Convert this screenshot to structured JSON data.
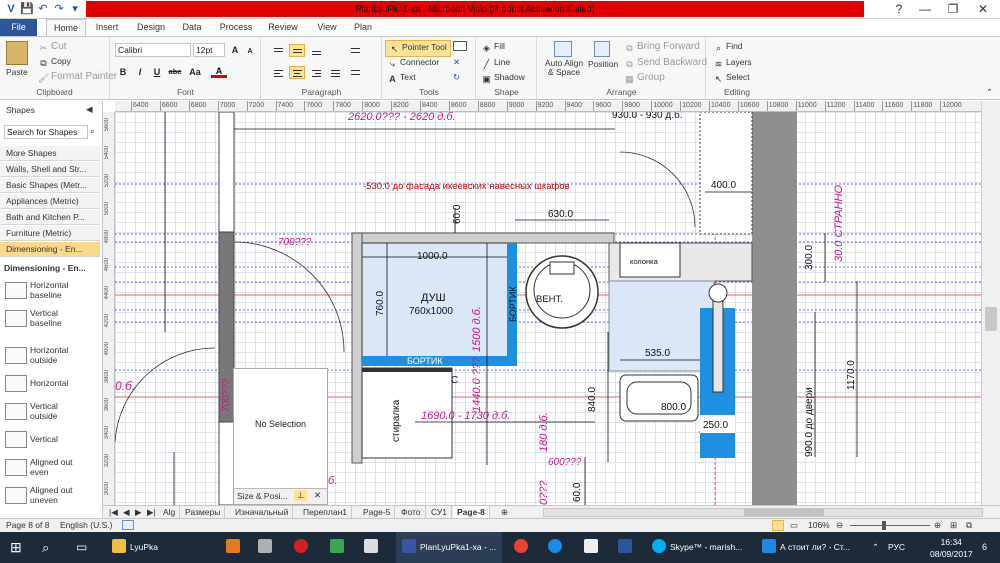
{
  "window": {
    "title": "PlanLyuPka1-xa - Microsoft Visio (Product Activation Failed)",
    "help": "?",
    "minimize": "—",
    "restore": "❐",
    "close": "✕"
  },
  "qat": [
    "💾",
    "↶",
    "↷",
    "▾"
  ],
  "tabs": [
    "File",
    "Home",
    "Insert",
    "Design",
    "Data",
    "Process",
    "Review",
    "View",
    "Plan"
  ],
  "ribbon": {
    "clipboard": {
      "label": "Clipboard",
      "paste": "Paste",
      "cut": "Cut",
      "copy": "Copy",
      "format_painter": "Format Painter"
    },
    "font": {
      "label": "Font",
      "family": "Calibri",
      "size": "12pt",
      "grow": "A",
      "shrink": "A",
      "bold": "B",
      "italic": "I",
      "underline": "U",
      "strike": "abc",
      "case": "Aa",
      "color": "A"
    },
    "paragraph": {
      "label": "Paragraph"
    },
    "tools": {
      "label": "Tools",
      "pointer": "Pointer Tool",
      "connector": "Connector",
      "text": "Text"
    },
    "shape": {
      "label": "Shape",
      "fill": "Fill",
      "line": "Line",
      "shadow": "Shadow"
    },
    "arrange": {
      "label": "Arrange",
      "auto_align": "Auto Align & Space",
      "position": "Position",
      "bring_forward": "Bring Forward",
      "send_backward": "Send Backward",
      "group": "Group"
    },
    "editing": {
      "label": "Editing",
      "find": "Find",
      "layers": "Layers",
      "select": "Select"
    }
  },
  "shapes_panel": {
    "title": "Shapes",
    "search_placeholder": "Search for Shapes",
    "stencils": [
      "More Shapes",
      "Walls, Shell and Str...",
      "Basic Shapes (Metr...",
      "Appliances (Metric)",
      "Bath and Kitchen P...",
      "Furniture (Metric)",
      "Dimensioning - En..."
    ],
    "section": "Dimensioning - En...",
    "masters": [
      [
        "Horizontal",
        "baseline"
      ],
      [
        "Vertical",
        "baseline"
      ],
      [
        "Horizontal",
        "outside"
      ],
      [
        "Horizontal",
        ""
      ],
      [
        "Vertical",
        "outside"
      ],
      [
        "Vertical",
        ""
      ],
      [
        "Aligned out",
        "even"
      ],
      [
        "Aligned out",
        "uneven"
      ]
    ]
  },
  "ruler_top": [
    "6400",
    "6600",
    "6800",
    "7000",
    "7200",
    "7400",
    "7600",
    "7800",
    "8000",
    "8200",
    "8400",
    "8600",
    "8800",
    "9000",
    "9200",
    "9400",
    "9600",
    "9800",
    "10000",
    "10200",
    "10400",
    "10600",
    "10800",
    "11000",
    "11200",
    "11400",
    "11600",
    "11800",
    "12000"
  ],
  "ruler_left": [
    "5600",
    "5400",
    "5200",
    "5000",
    "4800",
    "4600",
    "4400",
    "4200",
    "4000",
    "3800",
    "3600",
    "3400",
    "3200",
    "3000",
    "2800"
  ],
  "drawing": {
    "top_pink": "2620.0??? - 2620 д.б.",
    "top_right": "930.0 - 930 д.б.",
    "facade_note": "-530.0 до фасада икеевских навесных шкафов",
    "d400": "400.0",
    "strange": "30.0 СТРАННО",
    "d60": "60.0",
    "d630": "630.0",
    "d700": "700???",
    "d1000": "1000.0",
    "kolonka": "колонка",
    "d300": "300.0",
    "shower": "ДУШ",
    "shower_size": "760x1000",
    "d760": "760.0",
    "d1500": "1500 д.б.",
    "bortik_v": "БОРТИК",
    "vent": "ВЕНТ.",
    "bortik_h": "БОРТИК",
    "d1440": "1440.0 ???",
    "d535": "535.0",
    "d990": "990.0 до двери",
    "d1170": "1170.0",
    "d700_left": "700???",
    "stiralka": "стиралка",
    "c": "С",
    "d840": "840.0",
    "d800": "800.0",
    "d1690": "1690.0 - 1730 д.б.",
    "d250": "250.0",
    "d180": "180 д.б.",
    "d600": "600???",
    "d0": "0???",
    "d60b": "60.0",
    "ob": "0.б.",
    "b": "б."
  },
  "size_panel": {
    "text": "No Selection",
    "tab": "Size & Posi...",
    "pin": "⊥",
    "close": "✕"
  },
  "page_tabs": [
    "Alg",
    "Размеры",
    "Изначальный",
    "Переплан1",
    "Page-5",
    "Фото",
    "СУ1",
    "Page-8"
  ],
  "page_nav": [
    "|◀",
    "◀",
    "▶",
    "▶|"
  ],
  "status": {
    "page": "Page 8 of 8",
    "lang": "English (U.S.)",
    "zoom": "106%"
  },
  "taskbar": {
    "items": [
      "LyuPka",
      "PlanLyuPka1-xa - ...",
      "Skype™ - marish...",
      "А стоит ли? - Ст..."
    ],
    "lang": "РУС",
    "time": "16:34",
    "date": "08/09/2017",
    "notif": "6"
  }
}
